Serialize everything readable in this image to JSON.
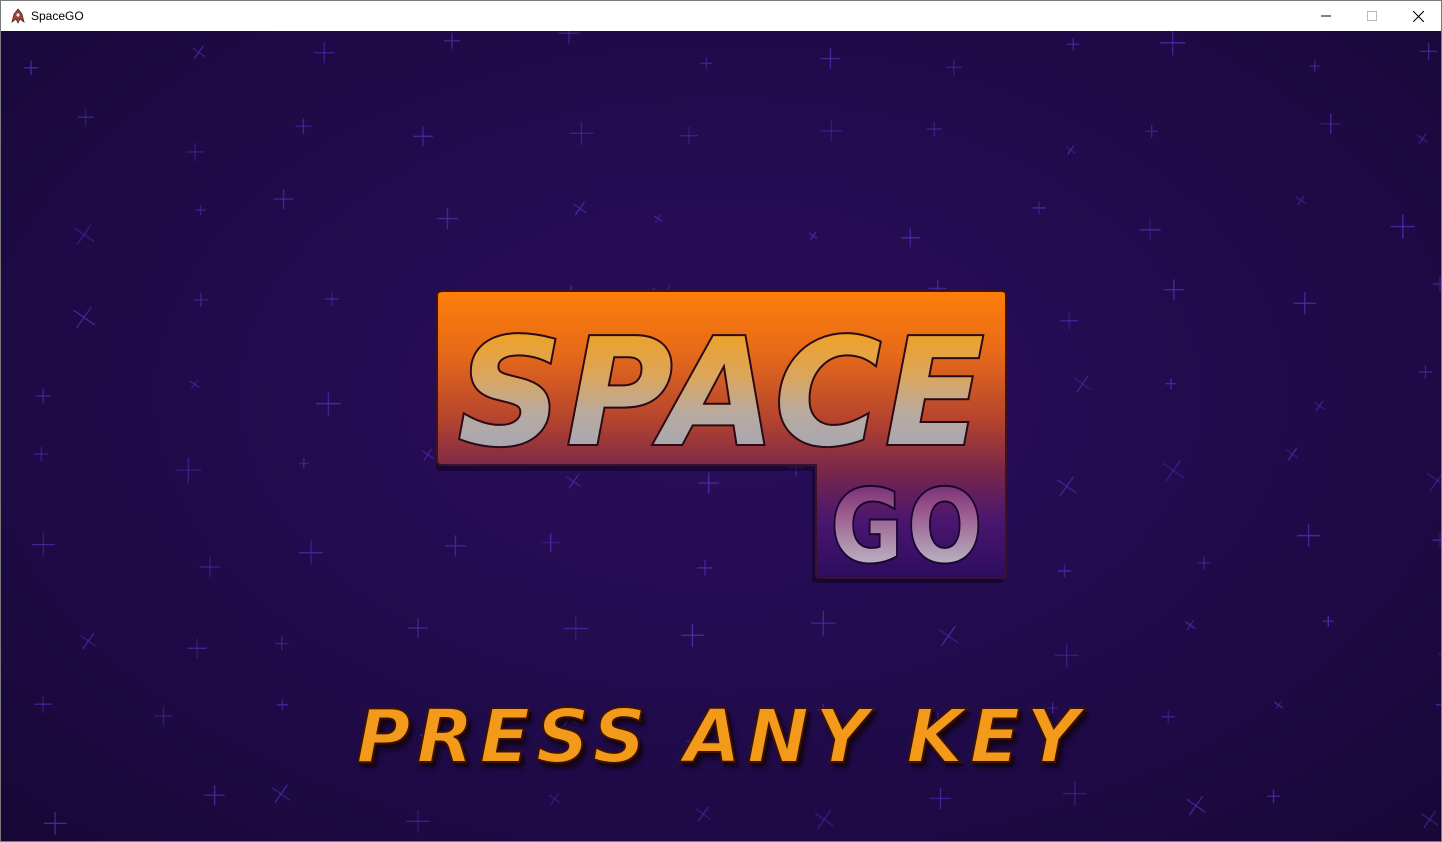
{
  "window": {
    "title": "SpaceGO",
    "app_icon": "spacego-app-icon",
    "controls": {
      "minimize": "minimize-icon",
      "maximize": "maximize-icon",
      "close": "close-icon"
    }
  },
  "logo": {
    "word1": "SPACE",
    "word2": "GO"
  },
  "prompt": "PRESS ANY KEY",
  "colors": {
    "background": "#240c52",
    "star": "#4a2aa8",
    "logo_orange": "#f27a0c",
    "logo_purple": "#3a1070",
    "prompt_orange": "#f49a1a"
  }
}
